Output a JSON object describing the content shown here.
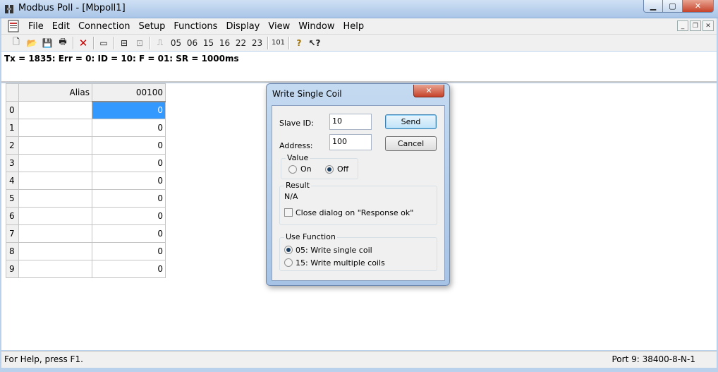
{
  "window": {
    "title": "Modbus Poll - [Mbpoll1]"
  },
  "menu": [
    "File",
    "Edit",
    "Connection",
    "Setup",
    "Functions",
    "Display",
    "View",
    "Window",
    "Help"
  ],
  "toolbar": {
    "function_codes": [
      "05",
      "06",
      "15",
      "16",
      "22",
      "23"
    ],
    "code_101": "101"
  },
  "status_line": "Tx = 1835: Err = 0: ID = 10: F = 01: SR = 1000ms",
  "grid": {
    "alias_header": "Alias",
    "value_header": "00100",
    "rows": [
      {
        "index": "0",
        "value": "0"
      },
      {
        "index": "1",
        "value": "0"
      },
      {
        "index": "2",
        "value": "0"
      },
      {
        "index": "3",
        "value": "0"
      },
      {
        "index": "4",
        "value": "0"
      },
      {
        "index": "5",
        "value": "0"
      },
      {
        "index": "6",
        "value": "0"
      },
      {
        "index": "7",
        "value": "0"
      },
      {
        "index": "8",
        "value": "0"
      },
      {
        "index": "9",
        "value": "0"
      }
    ],
    "selected_row": 0
  },
  "dialog": {
    "title": "Write Single Coil",
    "slave_id_label": "Slave ID:",
    "slave_id_value": "10",
    "address_label": "Address:",
    "address_value": "100",
    "send_label": "Send",
    "cancel_label": "Cancel",
    "value_group": "Value",
    "on_label": "On",
    "off_label": "Off",
    "value_selected": "Off",
    "result_group": "Result",
    "result_text": "N/A",
    "close_on_ok_label": "Close dialog on \"Response ok\"",
    "close_on_ok_checked": false,
    "function_group": "Use Function",
    "func_05_label": "05: Write single coil",
    "func_15_label": "15: Write multiple coils",
    "function_selected": "05"
  },
  "statusbar": {
    "help": "For Help, press F1.",
    "port": "Port 9: 38400-8-N-1"
  },
  "colors": {
    "selection": "#3399ff",
    "title_gradient": "#a9c5e7",
    "close_red": "#c6422a"
  }
}
